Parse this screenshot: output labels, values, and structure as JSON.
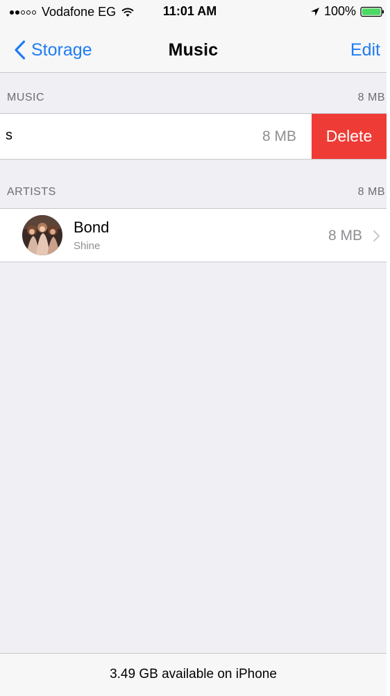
{
  "status_bar": {
    "carrier": "Vodafone EG",
    "signal_strength": 2,
    "signal_max": 5,
    "time": "11:01 AM",
    "battery": "100%",
    "icons": [
      "wifi-icon",
      "location-icon",
      "battery-icon"
    ]
  },
  "nav": {
    "back_label": "Storage",
    "title": "Music",
    "edit_label": "Edit"
  },
  "music_section": {
    "header": "MUSIC",
    "size": "8 MB",
    "row": {
      "residue_text": "s",
      "size": "8 MB",
      "delete_label": "Delete"
    }
  },
  "artists_section": {
    "header": "ARTISTS",
    "size": "8 MB",
    "items": [
      {
        "name": "Bond",
        "subtitle": "Shine",
        "size": "8 MB"
      }
    ]
  },
  "footer": {
    "available": "3.49 GB available on iPhone"
  },
  "colors": {
    "accent": "#1f7cf4",
    "delete": "#ee3b36",
    "background": "#efeff4",
    "secondary_text": "#8e8e93"
  }
}
